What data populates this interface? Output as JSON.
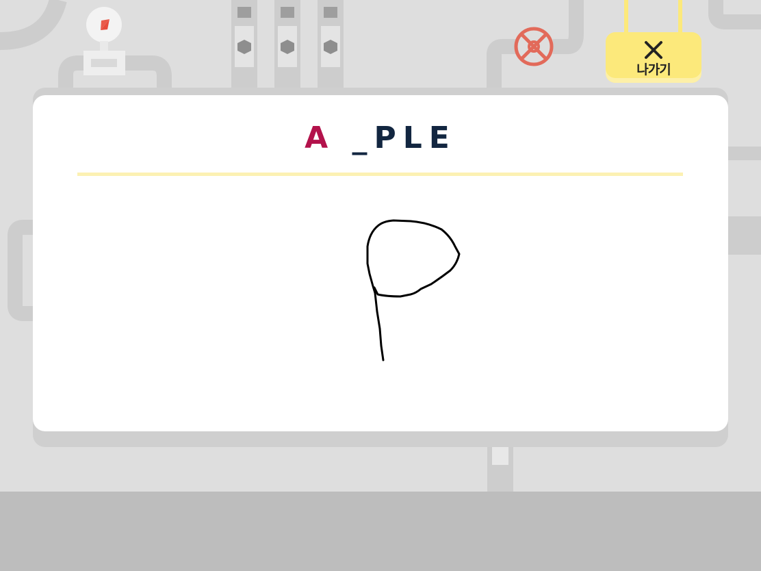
{
  "exit_button": {
    "label": "나가기",
    "icon": "close-icon"
  },
  "word_puzzle": {
    "first_letter": "A",
    "rest": "_PLE"
  },
  "drawing": {
    "stroke_color": "#000000",
    "description_letter": "P"
  },
  "colors": {
    "background": "#dedede",
    "floor": "#bdbdbd",
    "accent_yellow": "#fce97b",
    "highlight_letter": "#b3124b",
    "word_color": "#122640",
    "valve_red": "#e26a5a"
  }
}
